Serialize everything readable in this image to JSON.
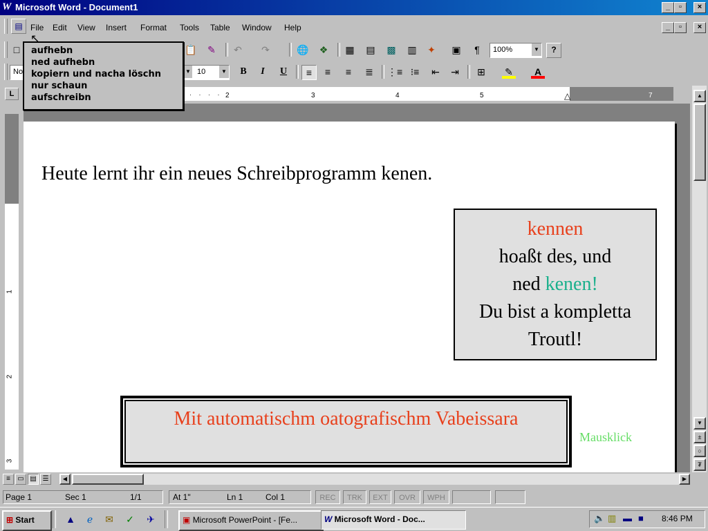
{
  "window": {
    "title": "Microsoft Word - Document1",
    "app_icon": "W"
  },
  "menu": {
    "items": [
      {
        "label": "File"
      },
      {
        "label": "Edit"
      },
      {
        "label": "View"
      },
      {
        "label": "Insert"
      },
      {
        "label": "Format"
      },
      {
        "label": "Tools"
      },
      {
        "label": "Table"
      },
      {
        "label": "Window"
      },
      {
        "label": "Help"
      }
    ]
  },
  "toolbar": {
    "zoom": "100%",
    "font_size": "10",
    "style": "No",
    "bold": "B",
    "italic": "I",
    "underline": "U",
    "pilcrow": "¶",
    "help": "?"
  },
  "popup_menu": {
    "items": [
      "aufhebn",
      "ned aufhebn",
      "kopiern und nacha löschn",
      "nur schaun",
      "aufschreibn"
    ]
  },
  "ruler": {
    "marks": [
      "1",
      "2",
      "3",
      "4",
      "5",
      "7"
    ]
  },
  "document": {
    "heading_text": "Heute lernt ihr ein neues Schreibprogramm kenen.",
    "callout": {
      "line1": "kennen",
      "line2": "hoaßt des, und",
      "line3_prefix": "ned",
      "line3_word": "kenen!",
      "line4": "Du bist a kompletta",
      "line5": "Troutl!"
    },
    "banner_text": "Mit automatischm oatografischm Vabeissara",
    "mausklick": "Mausklick"
  },
  "status": {
    "page": "Page 1",
    "sec": "Sec 1",
    "pages": "1/1",
    "at": "At 1\"",
    "ln": "Ln 1",
    "col": "Col 1",
    "rec": "REC",
    "trk": "TRK",
    "ext": "EXT",
    "ovr": "OVR",
    "wph": "WPH"
  },
  "taskbar": {
    "start": "Start",
    "tasks": [
      "Microsoft PowerPoint - [Fe...",
      "Microsoft Word - Doc..."
    ],
    "clock": "8:46 PM"
  },
  "colors": {
    "title_bar": "#000080",
    "callout_red": "#e8401c",
    "callout_teal": "#1ab08c",
    "banner_red": "#e8401c",
    "mausklick_green": "#66dd66"
  }
}
